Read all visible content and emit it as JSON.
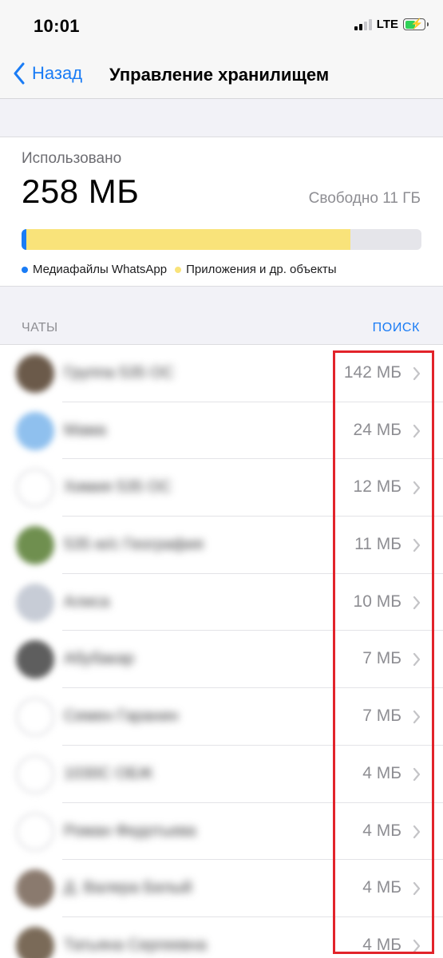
{
  "status_bar": {
    "time": "10:01",
    "network": "LTE"
  },
  "nav": {
    "back_label": "Назад",
    "title": "Управление хранилищем"
  },
  "usage": {
    "used_label": "Использовано",
    "used_value": "258 МБ",
    "free_value": "Свободно 11 ГБ",
    "bar_fractions": {
      "media": 0.012,
      "apps": 0.81
    },
    "legend": [
      {
        "label": "Медиафайлы WhatsApp",
        "color": "#1a7cf5"
      },
      {
        "label": "Приложения и др. объекты",
        "color": "#f9e37a"
      }
    ]
  },
  "chats_section": {
    "title": "ЧАТЫ",
    "action": "ПОИСК"
  },
  "chats": [
    {
      "name": "Группа 535 ОС",
      "size": "142 МБ",
      "avatar_color": "#6b5a4a",
      "avatar_style": "photo"
    },
    {
      "name": "Мама",
      "size": "24 МБ",
      "avatar_color": "#8fc0ee",
      "avatar_style": "photo"
    },
    {
      "name": "Химия 535 ОС",
      "size": "12 МБ",
      "avatar_color": "#ffffff",
      "avatar_style": "outline"
    },
    {
      "name": "535 ю/с География",
      "size": "11 МБ",
      "avatar_color": "#6f8f4f",
      "avatar_style": "photo"
    },
    {
      "name": "Алиса",
      "size": "10 МБ",
      "avatar_color": "#c7ccd6",
      "avatar_style": "photo"
    },
    {
      "name": "Абубакар",
      "size": "7 МБ",
      "avatar_color": "#5e5e5e",
      "avatar_style": "photo"
    },
    {
      "name": "Семен Гаранин",
      "size": "7 МБ",
      "avatar_color": "#ffffff",
      "avatar_style": "outline"
    },
    {
      "name": "1030С ОБЖ",
      "size": "4 МБ",
      "avatar_color": "#ffffff",
      "avatar_style": "outline"
    },
    {
      "name": "Роман Федотьева",
      "size": "4 МБ",
      "avatar_color": "#ffffff",
      "avatar_style": "outline"
    },
    {
      "name": "Д. Валера Белый",
      "size": "4 МБ",
      "avatar_color": "#8a7a6e",
      "avatar_style": "photo"
    },
    {
      "name": "Татьяна Сергеевна",
      "size": "4 МБ",
      "avatar_color": "#7a6a58",
      "avatar_style": "photo"
    }
  ]
}
